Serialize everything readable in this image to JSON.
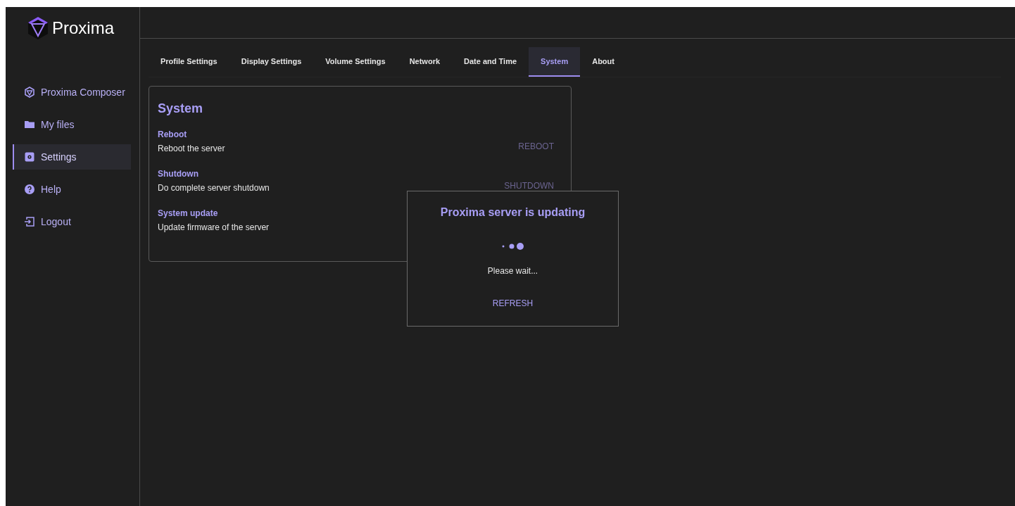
{
  "logo": {
    "text": "Proxima"
  },
  "sidebar": {
    "items": [
      {
        "label": "Proxima Composer",
        "selected": false
      },
      {
        "label": "My files",
        "selected": false
      },
      {
        "label": "Settings",
        "selected": true
      },
      {
        "label": "Help",
        "selected": false
      },
      {
        "label": "Logout",
        "selected": false
      }
    ]
  },
  "tabs": [
    {
      "label": "Profile Settings",
      "selected": false
    },
    {
      "label": "Display Settings",
      "selected": false
    },
    {
      "label": "Volume Settings",
      "selected": false
    },
    {
      "label": "Network",
      "selected": false
    },
    {
      "label": "Date and Time",
      "selected": false
    },
    {
      "label": "System",
      "selected": true
    },
    {
      "label": "About",
      "selected": false
    }
  ],
  "card": {
    "title": "System",
    "rows": [
      {
        "title": "Reboot",
        "description": "Reboot the server",
        "action": {
          "label": "REBOOT",
          "disabled": true
        }
      },
      {
        "title": "Shutdown",
        "description": "Do complete server shutdown",
        "action": {
          "label": "SHUTDOWN",
          "disabled": true
        }
      },
      {
        "title": "System update",
        "description": "Update firmware of the server"
      }
    ]
  },
  "dialog": {
    "title": "Proxima server is updating",
    "message": "Please wait...",
    "button": "REFRESH"
  }
}
